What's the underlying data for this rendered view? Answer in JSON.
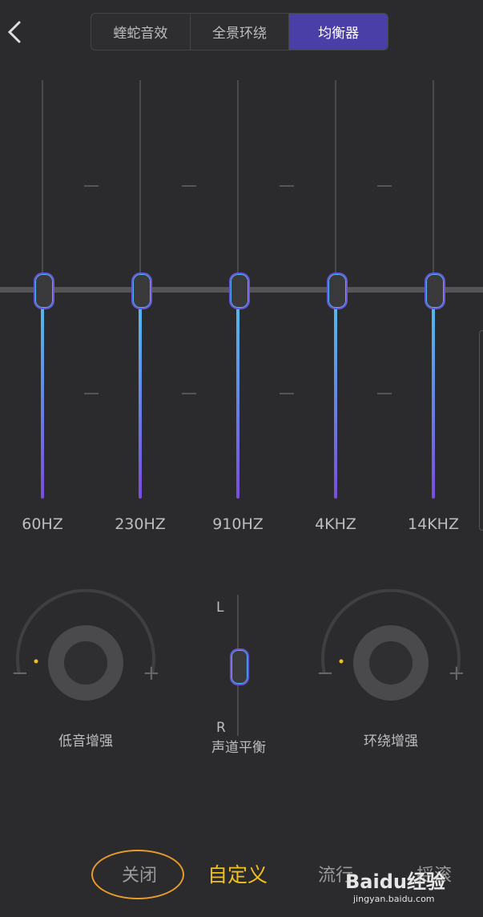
{
  "tabs": [
    {
      "label": "蝰蛇音效",
      "active": false
    },
    {
      "label": "全景环绕",
      "active": false
    },
    {
      "label": "均衡器",
      "active": true
    }
  ],
  "equalizer": {
    "bands": [
      {
        "label": "60HZ",
        "level": 0
      },
      {
        "label": "230HZ",
        "level": 0
      },
      {
        "label": "910HZ",
        "level": 0
      },
      {
        "label": "4KHZ",
        "level": 0
      },
      {
        "label": "14KHZ",
        "level": 0
      }
    ]
  },
  "bass": {
    "label": "低音增强",
    "minus": "−",
    "plus": "+"
  },
  "balance": {
    "label": "声道平衡",
    "left": "L",
    "right": "R"
  },
  "surround": {
    "label": "环绕增强",
    "minus": "−",
    "plus": "+"
  },
  "presets": [
    {
      "label": "关闭",
      "active": false
    },
    {
      "label": "自定义",
      "active": true
    },
    {
      "label": "流行",
      "active": false
    },
    {
      "label": "摇滚",
      "active": false
    }
  ],
  "watermark": {
    "text": "Baidu经验",
    "url": "jingyan.baidu.com"
  },
  "colors": {
    "accent": "#4a3fa6",
    "preset_active": "#f0c020",
    "highlight_circle": "#e89a2a"
  }
}
